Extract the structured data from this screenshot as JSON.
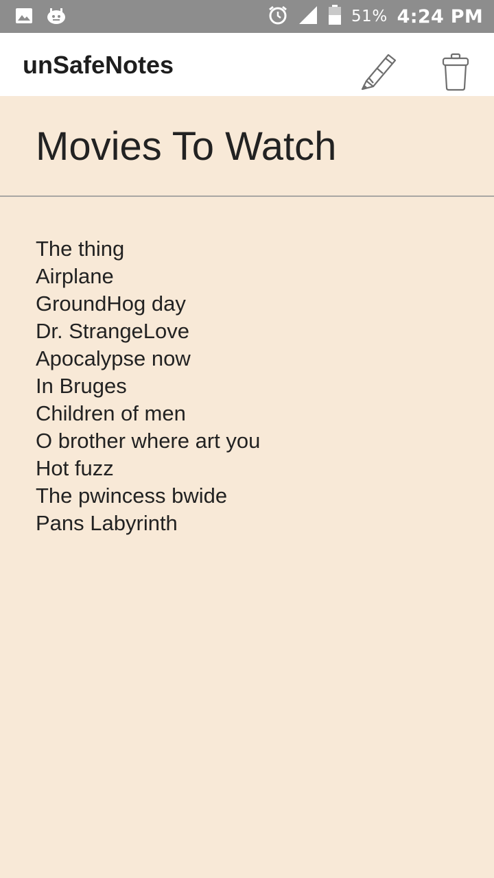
{
  "status_bar": {
    "left_icons": [
      "image-icon",
      "android-debug-icon"
    ],
    "right_icons": [
      "alarm-icon",
      "signal-icon",
      "battery-icon"
    ],
    "battery_percent": "51%",
    "time": "4:24 PM",
    "background_color": "#8d8d8d"
  },
  "app_bar": {
    "title": "unSafeNotes",
    "actions": [
      {
        "name": "edit",
        "icon": "pencil-icon"
      },
      {
        "name": "delete",
        "icon": "trash-icon"
      }
    ]
  },
  "note": {
    "title": "Movies To Watch",
    "lines": [
      "The thing",
      "Airplane",
      "GroundHog day",
      "Dr. StrangeLove",
      "Apocalypse now",
      "In Bruges",
      "Children of men",
      "O brother where art you",
      "Hot fuzz",
      "The pwincess bwide",
      "Pans Labyrinth"
    ],
    "background_color": "#f8e9d7"
  }
}
